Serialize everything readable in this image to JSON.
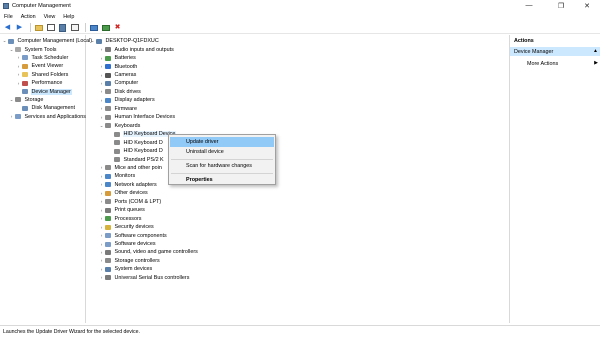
{
  "window": {
    "title": "Computer Management"
  },
  "menu": [
    "File",
    "Action",
    "View",
    "Help"
  ],
  "left_tree": [
    {
      "label": "Computer Management (Local)",
      "depth": 0,
      "expand": "v",
      "icon_color": "#6b8fb8"
    },
    {
      "label": "System Tools",
      "depth": 1,
      "expand": "v",
      "icon_color": "#a7a7a7"
    },
    {
      "label": "Task Scheduler",
      "depth": 2,
      "expand": ">",
      "icon_color": "#7a9cc6"
    },
    {
      "label": "Event Viewer",
      "depth": 2,
      "expand": ">",
      "icon_color": "#d69b3b"
    },
    {
      "label": "Shared Folders",
      "depth": 2,
      "expand": ">",
      "icon_color": "#e8c35a"
    },
    {
      "label": "Performance",
      "depth": 2,
      "expand": ">",
      "icon_color": "#c0504d"
    },
    {
      "label": "Device Manager",
      "depth": 2,
      "expand": "",
      "icon_color": "#6b8fb8",
      "selected": true
    },
    {
      "label": "Storage",
      "depth": 1,
      "expand": "v",
      "icon_color": "#8a8a8a"
    },
    {
      "label": "Disk Management",
      "depth": 2,
      "expand": "",
      "icon_color": "#6b8fb8"
    },
    {
      "label": "Services and Applications",
      "depth": 1,
      "expand": ">",
      "icon_color": "#7a9cc6"
    }
  ],
  "device_tree": [
    {
      "label": "DESKTOP-Q1FDXUC",
      "depth": 0,
      "expand": "v",
      "icon_color": "#5a7fa8"
    },
    {
      "label": "Audio inputs and outputs",
      "depth": 1,
      "expand": ">",
      "icon_color": "#7a7a7a"
    },
    {
      "label": "Batteries",
      "depth": 1,
      "expand": ">",
      "icon_color": "#4c9a4c"
    },
    {
      "label": "Bluetooth",
      "depth": 1,
      "expand": ">",
      "icon_color": "#2f6fd0"
    },
    {
      "label": "Cameras",
      "depth": 1,
      "expand": ">",
      "icon_color": "#555555"
    },
    {
      "label": "Computer",
      "depth": 1,
      "expand": ">",
      "icon_color": "#5a7fa8"
    },
    {
      "label": "Disk drives",
      "depth": 1,
      "expand": ">",
      "icon_color": "#8a8a8a"
    },
    {
      "label": "Display adapters",
      "depth": 1,
      "expand": ">",
      "icon_color": "#4a86c8"
    },
    {
      "label": "Firmware",
      "depth": 1,
      "expand": ">",
      "icon_color": "#8a8a8a"
    },
    {
      "label": "Human Interface Devices",
      "depth": 1,
      "expand": ">",
      "icon_color": "#8a8a8a"
    },
    {
      "label": "Keyboards",
      "depth": 1,
      "expand": "v",
      "icon_color": "#8a8a8a"
    },
    {
      "label": "HID Keyboard Device",
      "depth": 2,
      "expand": "",
      "icon_color": "#8a8a8a",
      "highlighted": true
    },
    {
      "label": "HID Keyboard D",
      "depth": 2,
      "expand": "",
      "icon_color": "#8a8a8a"
    },
    {
      "label": "HID Keyboard D",
      "depth": 2,
      "expand": "",
      "icon_color": "#8a8a8a"
    },
    {
      "label": "Standard PS/2 K",
      "depth": 2,
      "expand": "",
      "icon_color": "#8a8a8a"
    },
    {
      "label": "Mice and other poin",
      "depth": 1,
      "expand": ">",
      "icon_color": "#8a8a8a"
    },
    {
      "label": "Monitors",
      "depth": 1,
      "expand": ">",
      "icon_color": "#4a86c8"
    },
    {
      "label": "Network adapters",
      "depth": 1,
      "expand": ">",
      "icon_color": "#4a86c8"
    },
    {
      "label": "Other devices",
      "depth": 1,
      "expand": ">",
      "icon_color": "#d69b3b"
    },
    {
      "label": "Ports (COM & LPT)",
      "depth": 1,
      "expand": ">",
      "icon_color": "#8a8a8a"
    },
    {
      "label": "Print queues",
      "depth": 1,
      "expand": ">",
      "icon_color": "#7a7a7a"
    },
    {
      "label": "Processors",
      "depth": 1,
      "expand": ">",
      "icon_color": "#4c9a4c"
    },
    {
      "label": "Security devices",
      "depth": 1,
      "expand": ">",
      "icon_color": "#d6b43b"
    },
    {
      "label": "Software components",
      "depth": 1,
      "expand": ">",
      "icon_color": "#7a9cc6"
    },
    {
      "label": "Software devices",
      "depth": 1,
      "expand": ">",
      "icon_color": "#7a9cc6"
    },
    {
      "label": "Sound, video and game controllers",
      "depth": 1,
      "expand": ">",
      "icon_color": "#7a7a7a"
    },
    {
      "label": "Storage controllers",
      "depth": 1,
      "expand": ">",
      "icon_color": "#8a8a8a"
    },
    {
      "label": "System devices",
      "depth": 1,
      "expand": ">",
      "icon_color": "#5a7fa8"
    },
    {
      "label": "Universal Serial Bus controllers",
      "depth": 1,
      "expand": ">",
      "icon_color": "#7a7a7a"
    }
  ],
  "context_menu": {
    "items": [
      {
        "label": "Update driver",
        "bold": false,
        "highlighted": true
      },
      {
        "label": "Uninstall device",
        "bold": false
      },
      {
        "label": "Scan for hardware changes",
        "bold": false
      },
      {
        "label": "Properties",
        "bold": true
      }
    ]
  },
  "actions": {
    "header": "Actions",
    "section": "Device Manager",
    "more": "More Actions"
  },
  "status": {
    "text": "Launches the Update Driver Wizard for the selected device."
  },
  "colors": {
    "selection": "#cce8ff",
    "menu_highlight": "#91c9f7"
  }
}
